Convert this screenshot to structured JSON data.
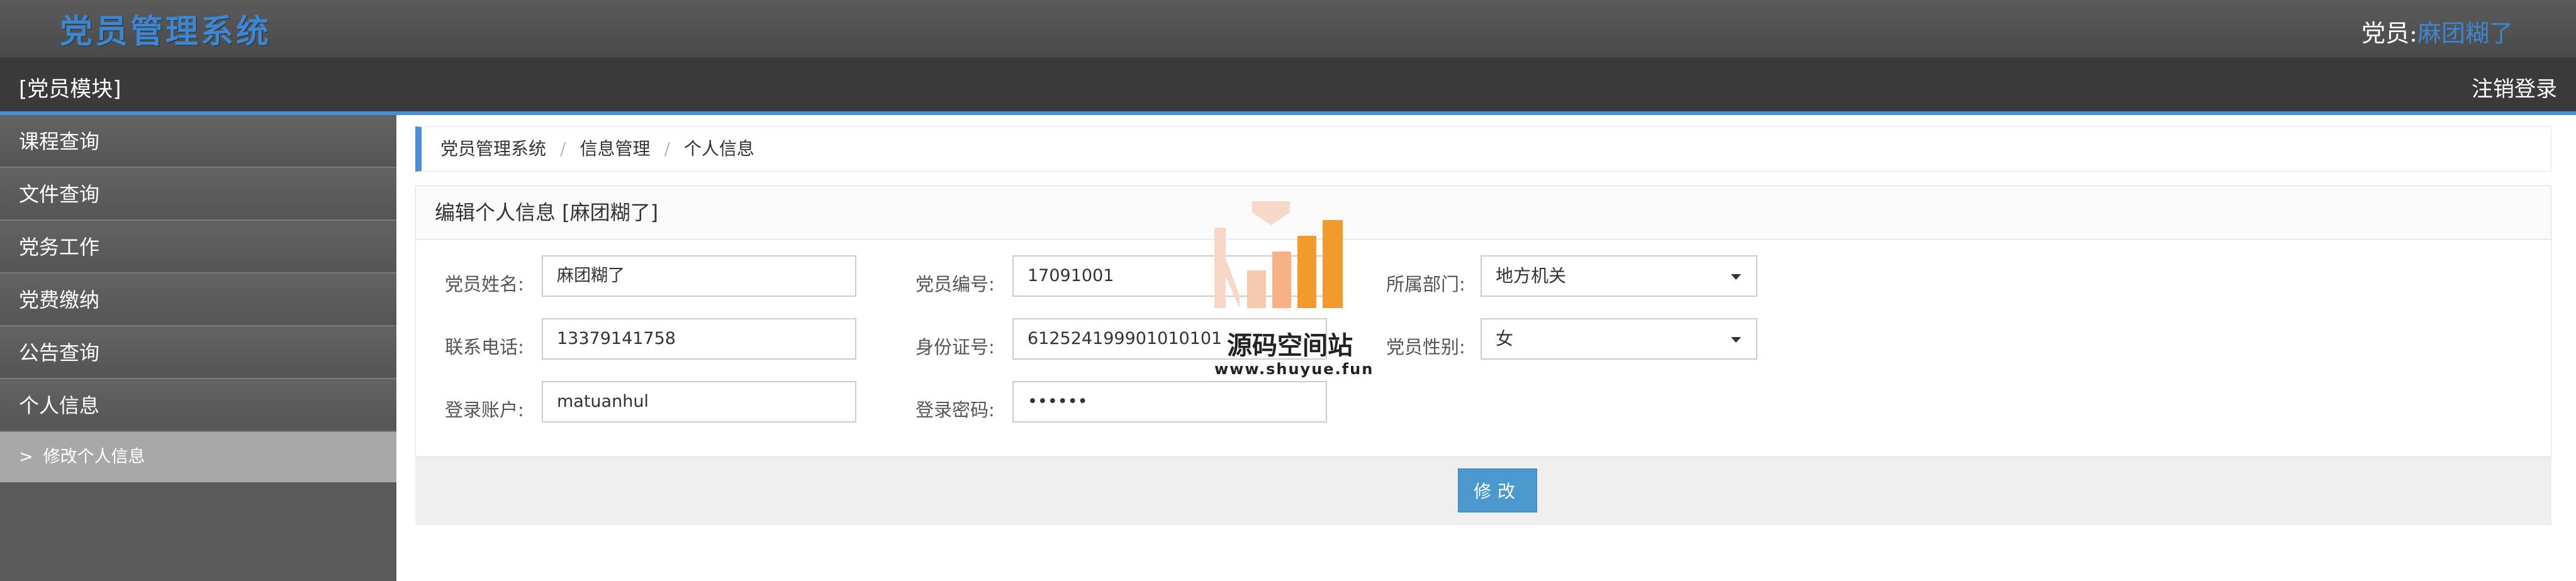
{
  "header": {
    "title": "党员管理系统",
    "user_label": "党员:",
    "user_name": "麻团糊了"
  },
  "module_bar": {
    "module_name": "[党员模块]",
    "logout": "注销登录"
  },
  "sidebar": {
    "items": [
      {
        "label": "课程查询"
      },
      {
        "label": "文件查询"
      },
      {
        "label": "党务工作"
      },
      {
        "label": "党费缴纳"
      },
      {
        "label": "公告查询"
      },
      {
        "label": "个人信息"
      }
    ],
    "sub_item": {
      "chevron": ">",
      "label": "修改个人信息"
    }
  },
  "breadcrumb": {
    "items": [
      "党员管理系统",
      "信息管理",
      "个人信息"
    ],
    "separator": "/"
  },
  "panel": {
    "title": "编辑个人信息 [麻团糊了]"
  },
  "form": {
    "name_label": "党员姓名:",
    "name_value": "麻团糊了",
    "phone_label": "联系电话:",
    "phone_value": "13379141758",
    "account_label": "登录账户:",
    "account_value": "matuanhul",
    "number_label": "党员编号:",
    "number_value": "17091001",
    "id_label": "身份证号:",
    "id_value": "612524199901010101",
    "password_label": "登录密码:",
    "password_value": "••••••",
    "dept_label": "所属部门:",
    "dept_value": "地方机关",
    "gender_label": "党员性别:",
    "gender_value": "女"
  },
  "submit_label": "修改",
  "watermark": {
    "text": "源码空间站",
    "url": "www.shuyue.fun"
  },
  "colors": {
    "accent": "#4a8fd4",
    "title_blue": "#3d86d1",
    "button": "#4a98cd",
    "watermark_orange": "#f39a2c"
  }
}
